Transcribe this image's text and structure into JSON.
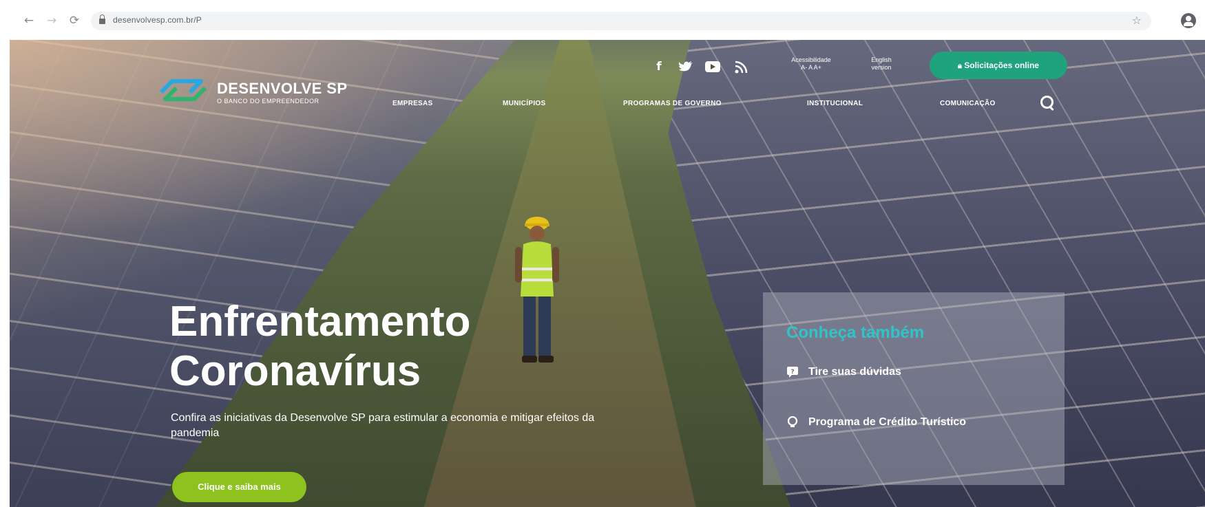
{
  "browser": {
    "url": "desenvolvesp.com.br/P",
    "back_icon": "arrow-left-icon",
    "forward_icon": "arrow-right-icon",
    "reload_icon": "reload-icon",
    "bookmark_icon": "star-icon",
    "profile_icon": "account-icon"
  },
  "header": {
    "logo": {
      "name": "DESENVOLVE SP",
      "tagline": "O BANCO DO EMPREENDEDOR"
    },
    "social_icons": [
      "facebook-icon",
      "twitter-icon",
      "youtube-icon",
      "rss-icon"
    ],
    "accessibility": {
      "line1": "Acessibilidade",
      "line2": "A- A  A+"
    },
    "language": {
      "line1": "English",
      "line2": "version"
    },
    "online_button": "Solicitações online",
    "nav": [
      "EMPRESAS",
      "MUNICÍPIOS",
      "PROGRAMAS DE GOVERNO",
      "INSTITUCIONAL",
      "COMUNICAÇÃO"
    ]
  },
  "hero": {
    "title_line1": "Enfrentamento",
    "title_line2": "Coronavírus",
    "subtitle": "Confira as iniciativas da Desenvolve SP para estimular a economia e mitigar efeitos da pandemia",
    "cta": "Clique e saiba mais"
  },
  "side_panel": {
    "title": "Conheça também",
    "items": [
      {
        "icon": "chat-bubble-icon",
        "label": "Tire suas dúvidas"
      },
      {
        "icon": "lightbulb-icon",
        "label": "Programa de Crédito Turístico"
      }
    ]
  },
  "colors": {
    "primary_green": "#1fa37c",
    "cta_green": "#8dc21f",
    "accent_teal": "#2ec5c9"
  }
}
